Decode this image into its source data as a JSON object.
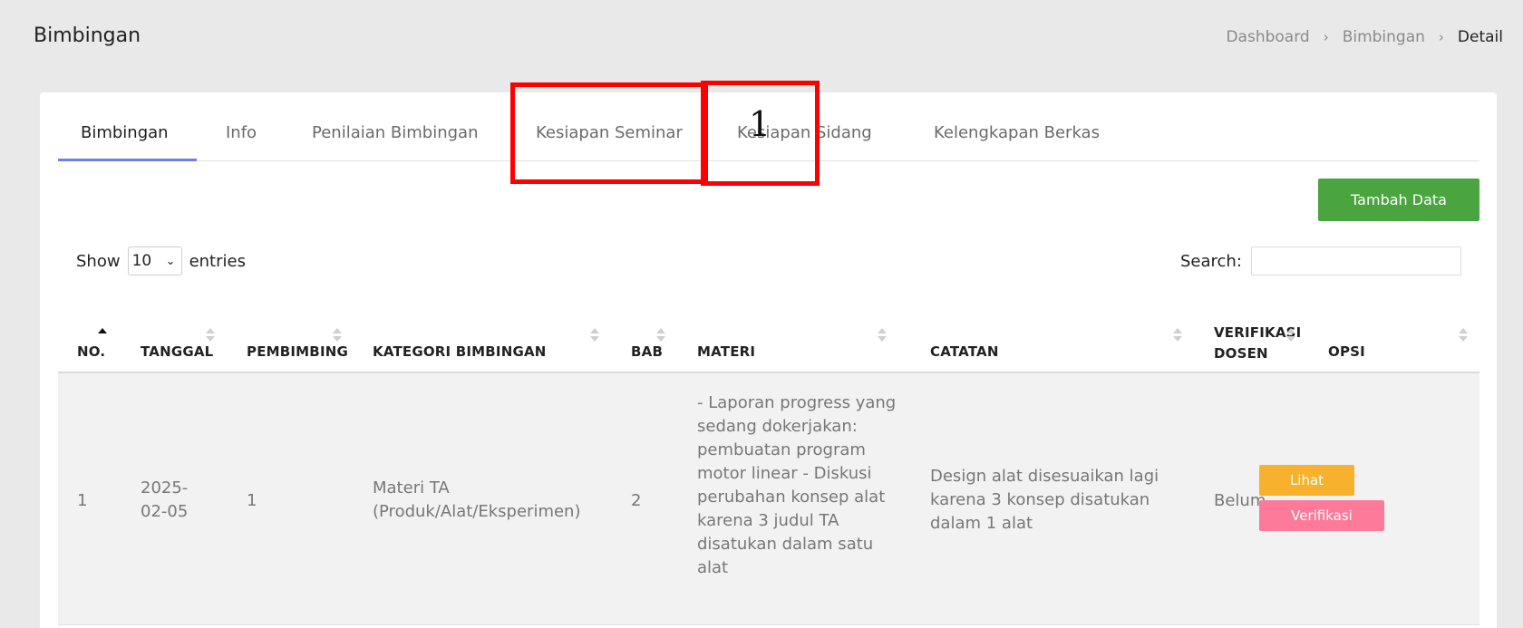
{
  "header": {
    "title": "Bimbingan",
    "breadcrumb": [
      "Dashboard",
      "Bimbingan",
      "Detail"
    ]
  },
  "tabs": [
    {
      "label": "Bimbingan",
      "active": true
    },
    {
      "label": "Info",
      "active": false
    },
    {
      "label": "Penilaian Bimbingan",
      "active": false
    },
    {
      "label": "Kesiapan Seminar",
      "active": false
    },
    {
      "label": "Kesiapan Sidang",
      "active": false
    },
    {
      "label": "Kelengkapan Berkas",
      "active": false
    }
  ],
  "annotation": {
    "number": "1",
    "color": "#ff0000"
  },
  "toolbar": {
    "add_label": "Tambah Data"
  },
  "entries": {
    "show": "Show",
    "value": "10",
    "suffix": "entries"
  },
  "search": {
    "label": "Search:",
    "value": ""
  },
  "table": {
    "headers": [
      "NO.",
      "TANGGAL",
      "PEMBIMBING",
      "KATEGORI BIMBINGAN",
      "BAB",
      "MATERI",
      "CATATAN",
      "VERIFIKASI DOSEN",
      "OPSI"
    ],
    "sort": {
      "column": "NO.",
      "direction": "asc"
    },
    "rows": [
      {
        "no": "1",
        "tanggal": "2025-02-05",
        "pembimbing": "1",
        "kategori": "Materi TA (Produk/Alat/Eksperimen)",
        "bab": "2",
        "materi": "- Laporan progress yang sedang dokerjakan: pembuatan program motor linear - Diskusi perubahan konsep alat karena 3 judul TA disatukan dalam satu alat",
        "catatan": "Design alat disesuaikan lagi karena 3 konsep disatukan dalam 1 alat",
        "verifikasi": "Belum",
        "actions": {
          "lihat": "Lihat",
          "verifikasi": "Verifikasi"
        }
      }
    ]
  },
  "colors": {
    "accent": "#6f7fe0",
    "add_button": "#4aa43f",
    "lihat_button": "#f7b12d",
    "verifikasi_button": "#fe7a9b",
    "annotation": "#ff0000"
  }
}
